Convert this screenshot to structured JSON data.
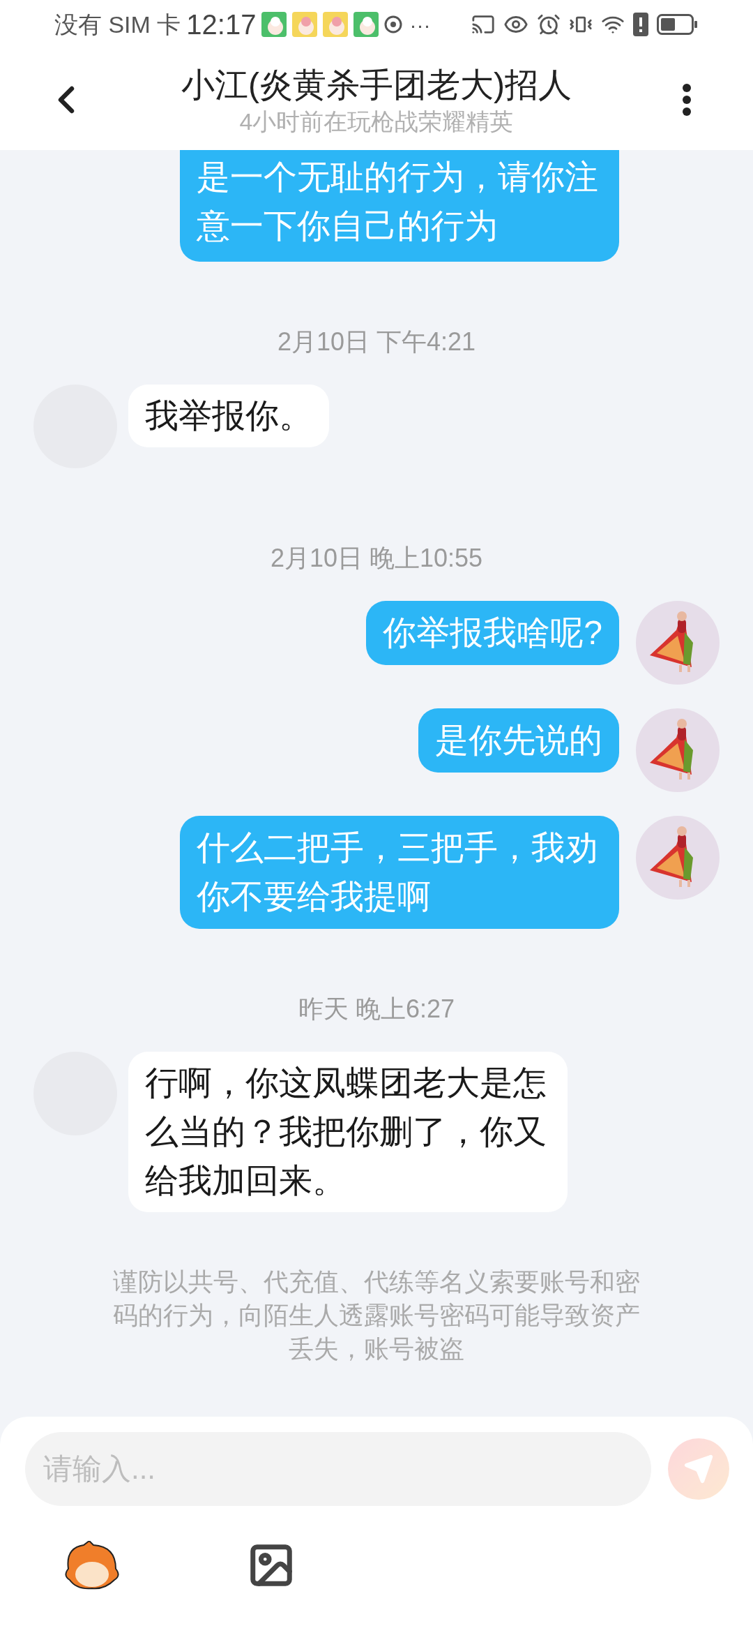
{
  "status_bar": {
    "carrier": "没有 SIM 卡",
    "time": "12:17",
    "more": "···"
  },
  "header": {
    "title": "小江(炎黄杀手团老大)招人",
    "subtitle": "4小时前在玩枪战荣耀精英"
  },
  "messages": [
    {
      "kind": "sent",
      "partial": true,
      "text": "是一个无耻的行为，请你注意一下你自己的行为"
    },
    {
      "kind": "timestamp",
      "text": "2月10日 下午4:21"
    },
    {
      "kind": "received",
      "text": "我举报你。"
    },
    {
      "kind": "timestamp",
      "text": "2月10日 晚上10:55"
    },
    {
      "kind": "sent",
      "text": "你举报我啥呢?"
    },
    {
      "kind": "sent",
      "text": "是你先说的"
    },
    {
      "kind": "sent",
      "text": "什么二把手，三把手，我劝你不要给我提啊"
    },
    {
      "kind": "timestamp",
      "text": "昨天 晚上6:27"
    },
    {
      "kind": "received",
      "text": "行啊，你这凤蝶团老大是怎么当的？我把你删了，你又给我加回来。"
    },
    {
      "kind": "notice",
      "text": "谨防以共号、代充值、代练等名义索要账号和密码的行为，向陌生人透露账号密码可能导致资产丢失，账号被盗"
    }
  ],
  "composer": {
    "placeholder": "请输入...",
    "send_disabled": true
  }
}
